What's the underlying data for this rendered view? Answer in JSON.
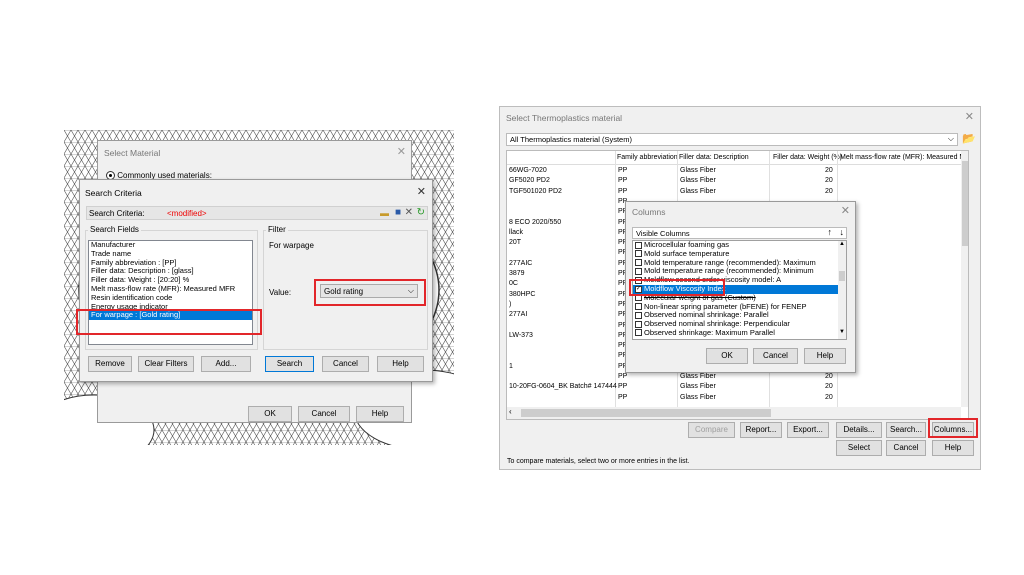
{
  "left": {
    "bg_dialog": {
      "title": "Select Material",
      "radio_label": "Commonly used materials:",
      "ok": "OK",
      "cancel": "Cancel",
      "help": "Help"
    },
    "dialog": {
      "title": "Search Criteria",
      "criteria_label": "Search Criteria:",
      "criteria_value": "<modified>",
      "fields_group": "Search Fields",
      "fields": [
        "Manufacturer",
        "Trade name",
        "Family abbreviation : [PP]",
        "Filler data: Description : [glass]",
        "Filler data: Weight : [20:20] %",
        "Melt mass-flow rate (MFR): Measured MFR",
        "Resin identification code",
        "Energy usage indicator",
        "For warpage : [Gold rating]"
      ],
      "filter_group": "Filter",
      "filter_text": "For warpage",
      "value_label": "Value:",
      "value_selected": "Gold rating",
      "buttons": {
        "remove": "Remove",
        "clear": "Clear Filters",
        "add": "Add...",
        "search": "Search",
        "cancel": "Cancel",
        "help": "Help"
      }
    }
  },
  "right": {
    "title": "Select Thermoplastics material",
    "dropdown": "All Thermoplastics material (System)",
    "headers": [
      "Family abbreviation",
      "Filler data: Description",
      "Filler data: Weight (%)",
      "Melt mass-flow rate (MFR): Measured MFR"
    ],
    "rows": [
      {
        "name": "66WG-7020",
        "fam": "PP",
        "desc": "Glass Fiber",
        "w": "20"
      },
      {
        "name": "GF5020 PD2",
        "fam": "PP",
        "desc": "Glass Fiber",
        "w": "20"
      },
      {
        "name": "TGF501020 PD2",
        "fam": "PP",
        "desc": "Glass Fiber",
        "w": "20"
      },
      {
        "name": "",
        "fam": "PP",
        "desc": "",
        "w": ""
      },
      {
        "name": "",
        "fam": "PP",
        "desc": "",
        "w": ""
      },
      {
        "name": "8 ECO 2020/550",
        "fam": "PP",
        "desc": "",
        "w": ""
      },
      {
        "name": "llack",
        "fam": "PP",
        "desc": "",
        "w": ""
      },
      {
        "name": "20T",
        "fam": "PP",
        "desc": "",
        "w": ""
      },
      {
        "name": "",
        "fam": "PP",
        "desc": "",
        "w": ""
      },
      {
        "name": "277AIC",
        "fam": "PP",
        "desc": "",
        "w": ""
      },
      {
        "name": "3879",
        "fam": "PP",
        "desc": "",
        "w": ""
      },
      {
        "name": "0C",
        "fam": "PP",
        "desc": "",
        "w": ""
      },
      {
        "name": "380HPC",
        "fam": "PP",
        "desc": "",
        "w": ""
      },
      {
        "name": ")",
        "fam": "PP",
        "desc": "",
        "w": ""
      },
      {
        "name": "277AI",
        "fam": "PP",
        "desc": "",
        "w": ""
      },
      {
        "name": "",
        "fam": "PP",
        "desc": "",
        "w": ""
      },
      {
        "name": "LW-373",
        "fam": "PP",
        "desc": "",
        "w": ""
      },
      {
        "name": "",
        "fam": "PP",
        "desc": "",
        "w": ""
      },
      {
        "name": "",
        "fam": "PP",
        "desc": "",
        "w": ""
      },
      {
        "name": "1",
        "fam": "PP",
        "desc": "",
        "w": ""
      },
      {
        "name": "",
        "fam": "PP",
        "desc": "Glass Fiber",
        "w": "20"
      },
      {
        "name": "10-20FG-0604_BK Batch# 147444",
        "fam": "PP",
        "desc": "Glass Fiber",
        "w": "20"
      },
      {
        "name": "",
        "fam": "PP",
        "desc": "Glass Fiber",
        "w": "20"
      }
    ],
    "buttons": {
      "compare": "Compare",
      "report": "Report...",
      "export": "Export...",
      "details": "Details...",
      "search": "Search...",
      "columns": "Columns...",
      "select": "Select",
      "cancel": "Cancel",
      "help": "Help"
    },
    "status": "To compare materials, select two or more entries in the list.",
    "columns_dialog": {
      "title": "Columns",
      "visible_label": "Visible Columns",
      "items": [
        {
          "label": "Microcellular foaming gas",
          "checked": false
        },
        {
          "label": "Mold surface temperature",
          "checked": false
        },
        {
          "label": "Mold temperature range (recommended): Maximum",
          "checked": false
        },
        {
          "label": "Mold temperature range (recommended): Minimum",
          "checked": false
        },
        {
          "label": "Moldflow second order viscosity model: A",
          "checked": false
        },
        {
          "label": "Moldflow Viscosity Index",
          "checked": true
        },
        {
          "label": "Molecular weight of gas (Custom)",
          "checked": false
        },
        {
          "label": "Non-linear spring parameter (bFENE) for FENEP",
          "checked": false
        },
        {
          "label": "Observed nominal shrinkage: Parallel",
          "checked": false
        },
        {
          "label": "Observed nominal shrinkage: Perpendicular",
          "checked": false
        },
        {
          "label": "Observed shrinkage: Maximum Parallel",
          "checked": false
        }
      ],
      "ok": "OK",
      "cancel": "Cancel",
      "help": "Help"
    }
  }
}
